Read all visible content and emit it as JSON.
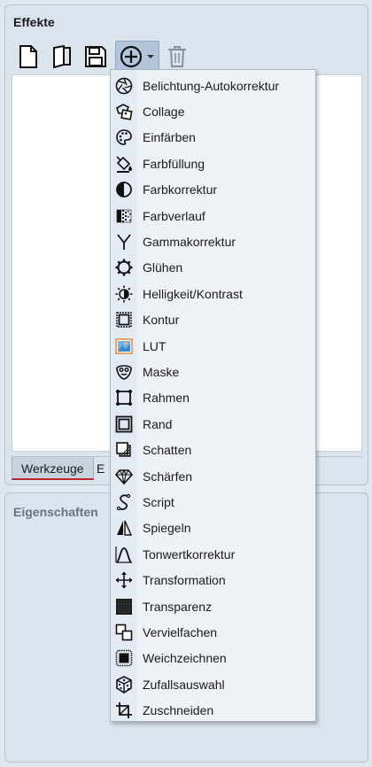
{
  "effects_panel": {
    "title": "Effekte"
  },
  "properties_panel": {
    "title": "Eigenschaften"
  },
  "tabs": [
    {
      "label": "Werkzeuge"
    },
    {
      "label": "E"
    }
  ],
  "toolbar": {
    "buttons": [
      {
        "icon": "new-document-icon"
      },
      {
        "icon": "open-document-icon"
      },
      {
        "icon": "save-icon"
      },
      {
        "icon": "add-effect-icon"
      },
      {
        "icon": "delete-icon"
      }
    ]
  },
  "menu": {
    "items": [
      {
        "label": "Belichtung-Autokorrektur",
        "icon": "aperture-icon"
      },
      {
        "label": "Collage",
        "icon": "collage-icon"
      },
      {
        "label": "Einfärben",
        "icon": "palette-icon"
      },
      {
        "label": "Farbfüllung",
        "icon": "paint-bucket-icon"
      },
      {
        "label": "Farbkorrektur",
        "icon": "half-circle-icon"
      },
      {
        "label": "Farbverlauf",
        "icon": "gradient-icon"
      },
      {
        "label": "Gammakorrektur",
        "icon": "gamma-icon"
      },
      {
        "label": "Glühen",
        "icon": "glow-icon"
      },
      {
        "label": "Helligkeit/Kontrast",
        "icon": "brightness-icon"
      },
      {
        "label": "Kontur",
        "icon": "contour-icon"
      },
      {
        "label": "LUT",
        "icon": "lut-icon"
      },
      {
        "label": "Maske",
        "icon": "mask-icon"
      },
      {
        "label": "Rahmen",
        "icon": "frame-icon"
      },
      {
        "label": "Rand",
        "icon": "border-icon"
      },
      {
        "label": "Schatten",
        "icon": "shadow-icon"
      },
      {
        "label": "Schärfen",
        "icon": "diamond-icon"
      },
      {
        "label": "Script",
        "icon": "script-icon"
      },
      {
        "label": "Spiegeln",
        "icon": "mirror-icon"
      },
      {
        "label": "Tonwertkorrektur",
        "icon": "tone-curve-icon"
      },
      {
        "label": "Transformation",
        "icon": "move-icon"
      },
      {
        "label": "Transparenz",
        "icon": "transparency-icon"
      },
      {
        "label": "Vervielfachen",
        "icon": "duplicate-icon"
      },
      {
        "label": "Weichzeichnen",
        "icon": "blur-icon"
      },
      {
        "label": "Zufallsauswahl",
        "icon": "dice-icon"
      },
      {
        "label": "Zuschneiden",
        "icon": "crop-icon"
      }
    ]
  }
}
